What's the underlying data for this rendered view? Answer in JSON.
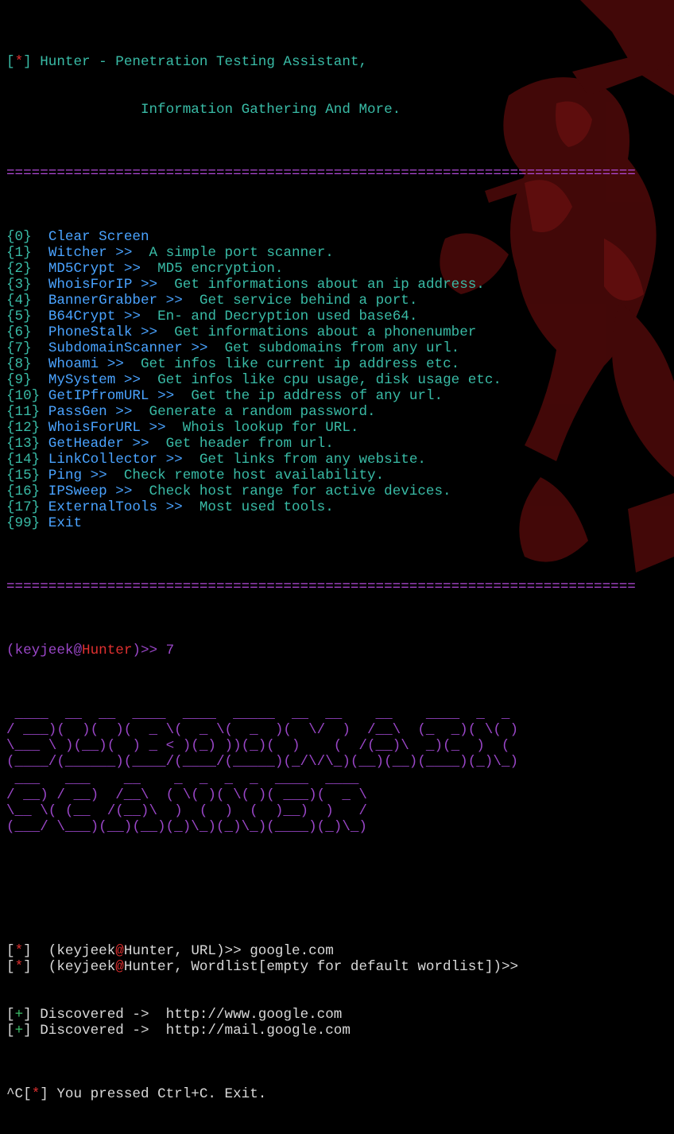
{
  "header": {
    "marker": "*",
    "title_line1": "Hunter - Penetration Testing Assistant,",
    "title_line2": "Information Gathering And More."
  },
  "separator": "===========================================================================",
  "menu": [
    {
      "num": "0",
      "name": "Clear Screen",
      "arrow": "",
      "desc": ""
    },
    {
      "num": "1",
      "name": "Witcher",
      "arrow": ">>",
      "desc": "A simple port scanner."
    },
    {
      "num": "2",
      "name": "MD5Crypt",
      "arrow": ">>",
      "desc": "MD5 encryption."
    },
    {
      "num": "3",
      "name": "WhoisForIP",
      "arrow": ">>",
      "desc": "Get informations about an ip address."
    },
    {
      "num": "4",
      "name": "BannerGrabber",
      "arrow": ">>",
      "desc": "Get service behind a port."
    },
    {
      "num": "5",
      "name": "B64Crypt",
      "arrow": ">>",
      "desc": "En- and Decryption used base64."
    },
    {
      "num": "6",
      "name": "PhoneStalk",
      "arrow": ">>",
      "desc": "Get informations about a phonenumber"
    },
    {
      "num": "7",
      "name": "SubdomainScanner",
      "arrow": ">>",
      "desc": "Get subdomains from any url."
    },
    {
      "num": "8",
      "name": "Whoami",
      "arrow": ">>",
      "desc": "Get infos like current ip address etc."
    },
    {
      "num": "9",
      "name": "MySystem",
      "arrow": ">>",
      "desc": "Get infos like cpu usage, disk usage etc."
    },
    {
      "num": "10",
      "name": "GetIPfromURL",
      "arrow": ">>",
      "desc": "Get the ip address of any url."
    },
    {
      "num": "11",
      "name": "PassGen",
      "arrow": ">>",
      "desc": "Generate a random password."
    },
    {
      "num": "12",
      "name": "WhoisForURL",
      "arrow": ">>",
      "desc": "Whois lookup for URL."
    },
    {
      "num": "13",
      "name": "GetHeader",
      "arrow": ">>",
      "desc": "Get header from url."
    },
    {
      "num": "14",
      "name": "LinkCollector",
      "arrow": ">>",
      "desc": "Get links from any website."
    },
    {
      "num": "15",
      "name": "Ping",
      "arrow": ">>",
      "desc": "Check remote host availability."
    },
    {
      "num": "16",
      "name": "IPSweep",
      "arrow": ">>",
      "desc": "Check host range for active devices."
    },
    {
      "num": "17",
      "name": "ExternalTools",
      "arrow": ">>",
      "desc": "Most used tools."
    },
    {
      "num": "99",
      "name": "Exit",
      "arrow": "",
      "desc": ""
    }
  ],
  "prompt": {
    "user": "keyjeek",
    "at": "@",
    "host": "Hunter",
    "suffix": ")>>",
    "input": "7"
  },
  "banner_art": [
    " ____  __  __  ____  ____  _____  __  __    __    ____  _  _ ",
    "/ ___)(  )(  )(  _ \\(  _ \\(  _  )(  \\/  )  /__\\  (_  _)( \\( )",
    "\\___ \\ )(__)(  ) _ < )(_) ))(_)(  )    (  /(__)\\  _)(_  )  ( ",
    "(____/(______)(____/(____/(_____)(_/\\/\\_)(__)(__)(____)(_)\\_)",
    " ___   ___    __    _  _  _  _  ____  ____ ",
    "/ __) / __)  /__\\  ( \\( )( \\( )( ___)(  _ \\",
    "\\__ \\( (__  /(__)\\  )  (  )  (  )__)  )   /",
    "(___/ \\___)(__)(__)(_)\\_)(_)\\_)(____)(_)\\_)"
  ],
  "scan_prompts": [
    {
      "marker": "*",
      "context": "URL",
      "input": "google.com"
    },
    {
      "marker": "*",
      "context": "Wordlist[empty for default wordlist]",
      "input": ""
    }
  ],
  "results": [
    {
      "marker": "+",
      "label": "Discovered ->",
      "url": "http://www.google.com"
    },
    {
      "marker": "+",
      "label": "Discovered ->",
      "url": "http://mail.google.com"
    }
  ],
  "exit_line": {
    "prefix": "^C",
    "marker": "*",
    "message": "You pressed Ctrl+C. Exit."
  },
  "colors": {
    "cyan": "#39bba6",
    "blue": "#4aa3ff",
    "separator": "#b04ad6",
    "red": "#e03030",
    "purple": "#9a46c8",
    "green": "#3cc06a",
    "background_art": "#5a0b0b"
  }
}
